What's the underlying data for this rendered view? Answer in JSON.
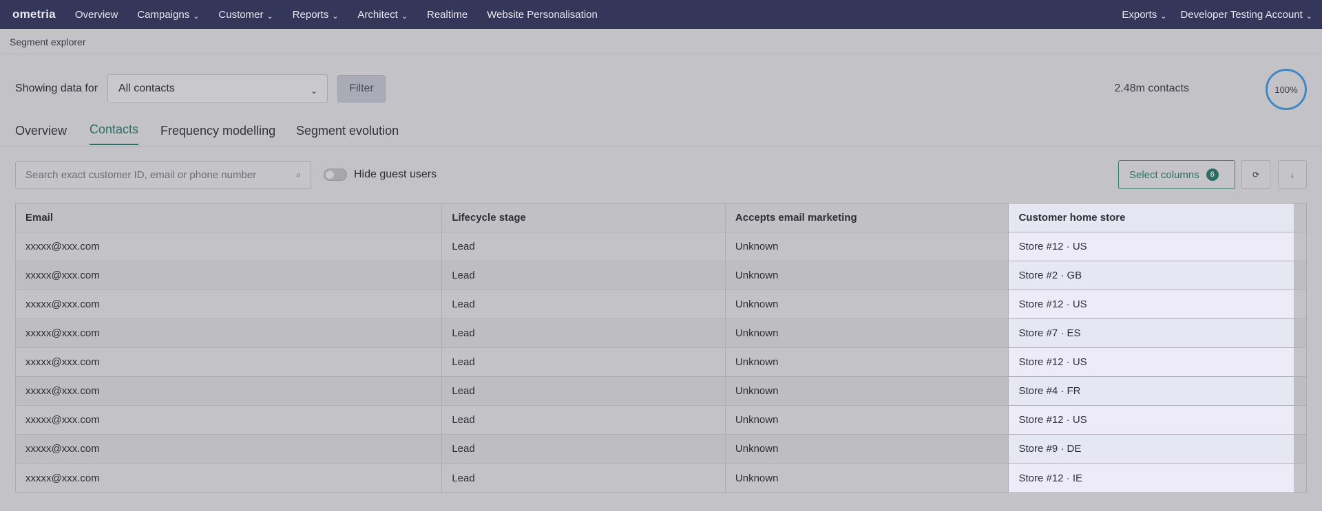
{
  "nav": {
    "logo": "ometria",
    "items": [
      {
        "label": "Overview",
        "dropdown": false
      },
      {
        "label": "Campaigns",
        "dropdown": true
      },
      {
        "label": "Customer",
        "dropdown": true
      },
      {
        "label": "Reports",
        "dropdown": true
      },
      {
        "label": "Architect",
        "dropdown": true
      },
      {
        "label": "Realtime",
        "dropdown": false
      },
      {
        "label": "Website Personalisation",
        "dropdown": false
      }
    ],
    "right": [
      {
        "label": "Exports",
        "dropdown": true
      },
      {
        "label": "Developer Testing Account",
        "dropdown": true
      }
    ],
    "chevron": "⌄"
  },
  "breadcrumb": "Segment explorer",
  "filterbar": {
    "label": "Showing data for",
    "selected": "All contacts",
    "filter_button": "Filter",
    "contacts_count": "2.48m contacts",
    "percent": "100%"
  },
  "tabs": [
    {
      "label": "Overview",
      "active": false
    },
    {
      "label": "Contacts",
      "active": true
    },
    {
      "label": "Frequency modelling",
      "active": false
    },
    {
      "label": "Segment evolution",
      "active": false
    }
  ],
  "toolbar": {
    "search_placeholder": "Search exact customer ID, email or phone number",
    "search_icon": "⌕",
    "toggle_label": "Hide guest users",
    "toggle_on": false,
    "select_columns_label": "Select columns",
    "select_columns_count": "6",
    "refresh_icon": "⟳",
    "download_icon": "↓"
  },
  "table": {
    "headers": [
      "Email",
      "Lifecycle stage",
      "Accepts email marketing",
      "Customer home store"
    ],
    "rows": [
      [
        "xxxxx@xxx.com",
        "Lead",
        "Unknown",
        "Store #12 · US"
      ],
      [
        "xxxxx@xxx.com",
        "Lead",
        "Unknown",
        "Store #2 · GB"
      ],
      [
        "xxxxx@xxx.com",
        "Lead",
        "Unknown",
        "Store #12 · US"
      ],
      [
        "xxxxx@xxx.com",
        "Lead",
        "Unknown",
        "Store #7 · ES"
      ],
      [
        "xxxxx@xxx.com",
        "Lead",
        "Unknown",
        "Store #12 · US"
      ],
      [
        "xxxxx@xxx.com",
        "Lead",
        "Unknown",
        "Store #4 · FR"
      ],
      [
        "xxxxx@xxx.com",
        "Lead",
        "Unknown",
        "Store #12 · US"
      ],
      [
        "xxxxx@xxx.com",
        "Lead",
        "Unknown",
        "Store #9 · DE"
      ],
      [
        "xxxxx@xxx.com",
        "Lead",
        "Unknown",
        "Store #12 · IE"
      ]
    ]
  },
  "colors": {
    "nav_bg": "#35375a",
    "accent": "#2c6e63",
    "ring": "#3f88c3",
    "highlight_column": "#edebf8"
  }
}
